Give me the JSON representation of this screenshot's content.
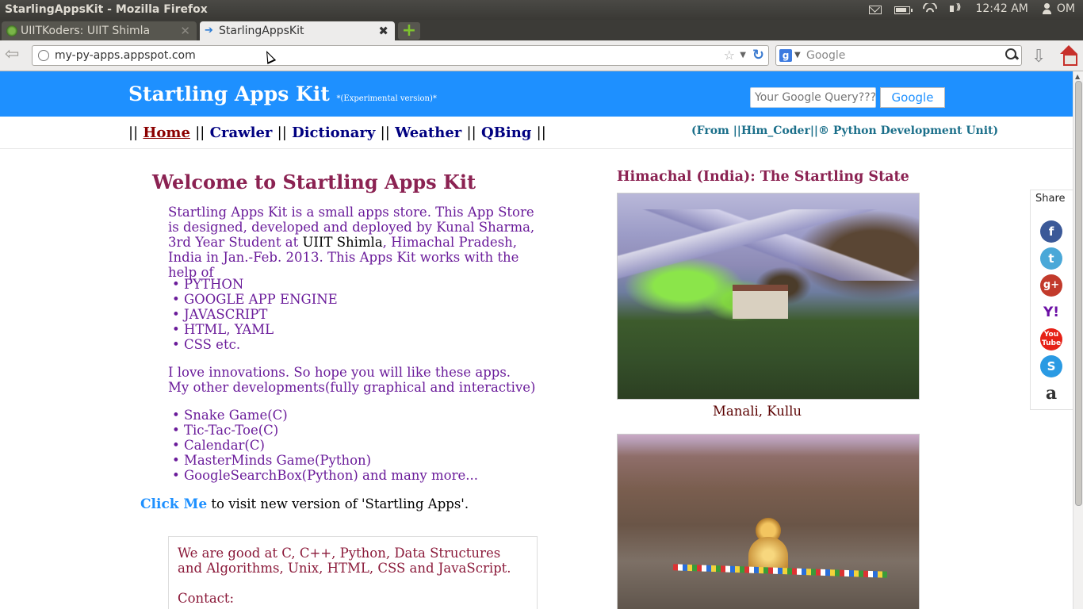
{
  "os_panel": {
    "window_title": "StarlingAppsKit - Mozilla Firefox",
    "clock": "12:42 AM",
    "user": "OM"
  },
  "browser": {
    "tabs": [
      {
        "title": "UIITKoders: UIIT Shimla",
        "active": false
      },
      {
        "title": "StarlingAppsKit",
        "active": true
      }
    ],
    "url": "my-py-apps.appspot.com",
    "search_placeholder": "Google",
    "scroll_position_fraction": 0.0
  },
  "site": {
    "title": "Startling Apps Kit",
    "subtitle": "*(Experimental version)*",
    "search_placeholder": "Your Google Query???",
    "search_button": "Google",
    "nav": {
      "home": "Home",
      "crawler": "Crawler",
      "dictionary": "Dictionary",
      "weather": "Weather",
      "qbing": "QBing",
      "sep": "||"
    },
    "from_line": "(From ||Him_Coder||® Python Development Unit)",
    "welcome_heading": "Welcome to Startling Apps Kit",
    "intro": {
      "part1": "Startling Apps Kit is a small apps store. This App Store is designed, developed and deployed by Kunal Sharma, 3rd Year Student at ",
      "college": "UIIT Shimla",
      "part2": ", Himachal Pradesh, India in Jan.-Feb. 2013. This Apps Kit works with the help of"
    },
    "technologies": [
      "PYTHON",
      "GOOGLE APP ENGINE",
      "JAVASCRIPT",
      "HTML, YAML",
      "CSS etc."
    ],
    "love_line1": "I love innovations. So hope you will like these apps.",
    "love_line2": "My other developments(fully graphical and interactive)",
    "developments": [
      "Snake Game(C)",
      "Tic-Tac-Toe(C)",
      "Calendar(C)",
      "MasterMinds Game(Python)",
      "GoogleSearchBox(Python) and many more..."
    ],
    "click_me": "Click Me",
    "click_rest": " to visit new version of 'Startling Apps'.",
    "good_at": "We are good at C, C++, Python, Data Structures and Algorithms, Unix, HTML, CSS and JavaScript.",
    "contact": "Contact:",
    "right_heading": "Himachal (India): The Startling State",
    "photo1_caption": "Manali, Kullu",
    "share_label": "Share",
    "icon_colors": {
      "header_blue": "#1e90ff",
      "heading_maroon": "#8b2252",
      "text_purple": "#6a1b9a"
    }
  }
}
